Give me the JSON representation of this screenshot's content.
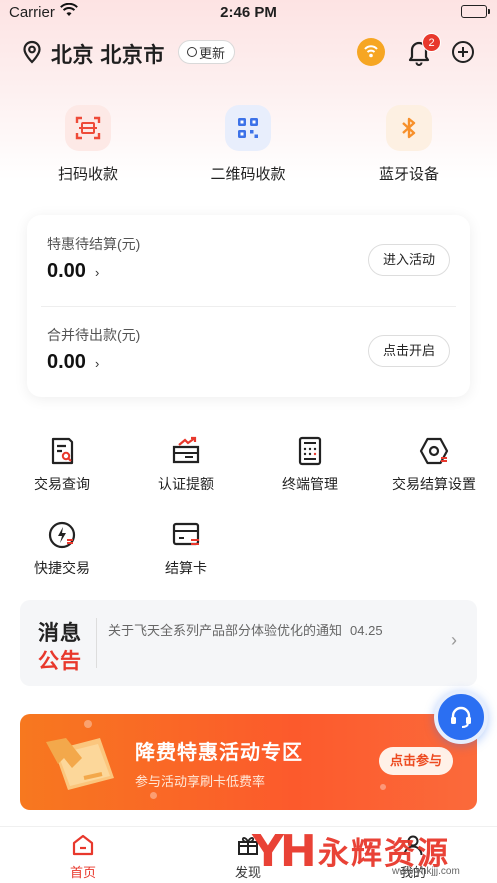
{
  "status_bar": {
    "carrier": "Carrier",
    "time": "2:46 PM"
  },
  "header": {
    "location": "北京 北京市",
    "refresh_label": "更新",
    "notification_count": "2",
    "icons": [
      "location-pin-icon",
      "shield-icon",
      "bell-icon",
      "plus-circle-icon"
    ]
  },
  "quick_actions": [
    {
      "label": "扫码收款",
      "icon": "scan-icon"
    },
    {
      "label": "二维码收款",
      "icon": "qrcode-icon"
    },
    {
      "label": "蓝牙设备",
      "icon": "bluetooth-icon"
    }
  ],
  "balances": [
    {
      "title": "特惠待结算(元)",
      "amount": "0.00",
      "button": "进入活动"
    },
    {
      "title": "合并待出款(元)",
      "amount": "0.00",
      "button": "点击开启"
    }
  ],
  "services": [
    {
      "label": "交易查询",
      "icon": "transaction-search-icon"
    },
    {
      "label": "认证提额",
      "icon": "credit-increase-icon"
    },
    {
      "label": "终端管理",
      "icon": "terminal-icon"
    },
    {
      "label": "交易结算设置",
      "icon": "settlement-settings-icon"
    },
    {
      "label": "快捷交易",
      "icon": "quick-trade-icon"
    },
    {
      "label": "结算卡",
      "icon": "settlement-card-icon"
    }
  ],
  "notice": {
    "heading_top": "消息",
    "heading_bottom": "公告",
    "text": "关于飞天全系列产品部分体验优化的通知",
    "date": "04.25"
  },
  "promo": {
    "title": "降费特惠活动专区",
    "subtitle": "参与活动享刷卡低费率",
    "cta": "点击参与"
  },
  "tabs": [
    {
      "label": "首页",
      "icon": "home-icon",
      "active": true
    },
    {
      "label": "发现",
      "icon": "gift-icon",
      "active": false
    },
    {
      "label": "我的",
      "icon": "user-icon",
      "active": false
    }
  ],
  "watermark": {
    "logo": "YH",
    "name": "永辉资源网",
    "url": "www.yhkjjj.com"
  },
  "colors": {
    "accent": "#e8382c",
    "promo": "#fc5a2c",
    "support": "#2b6ff2",
    "shield": "#f6a623"
  }
}
